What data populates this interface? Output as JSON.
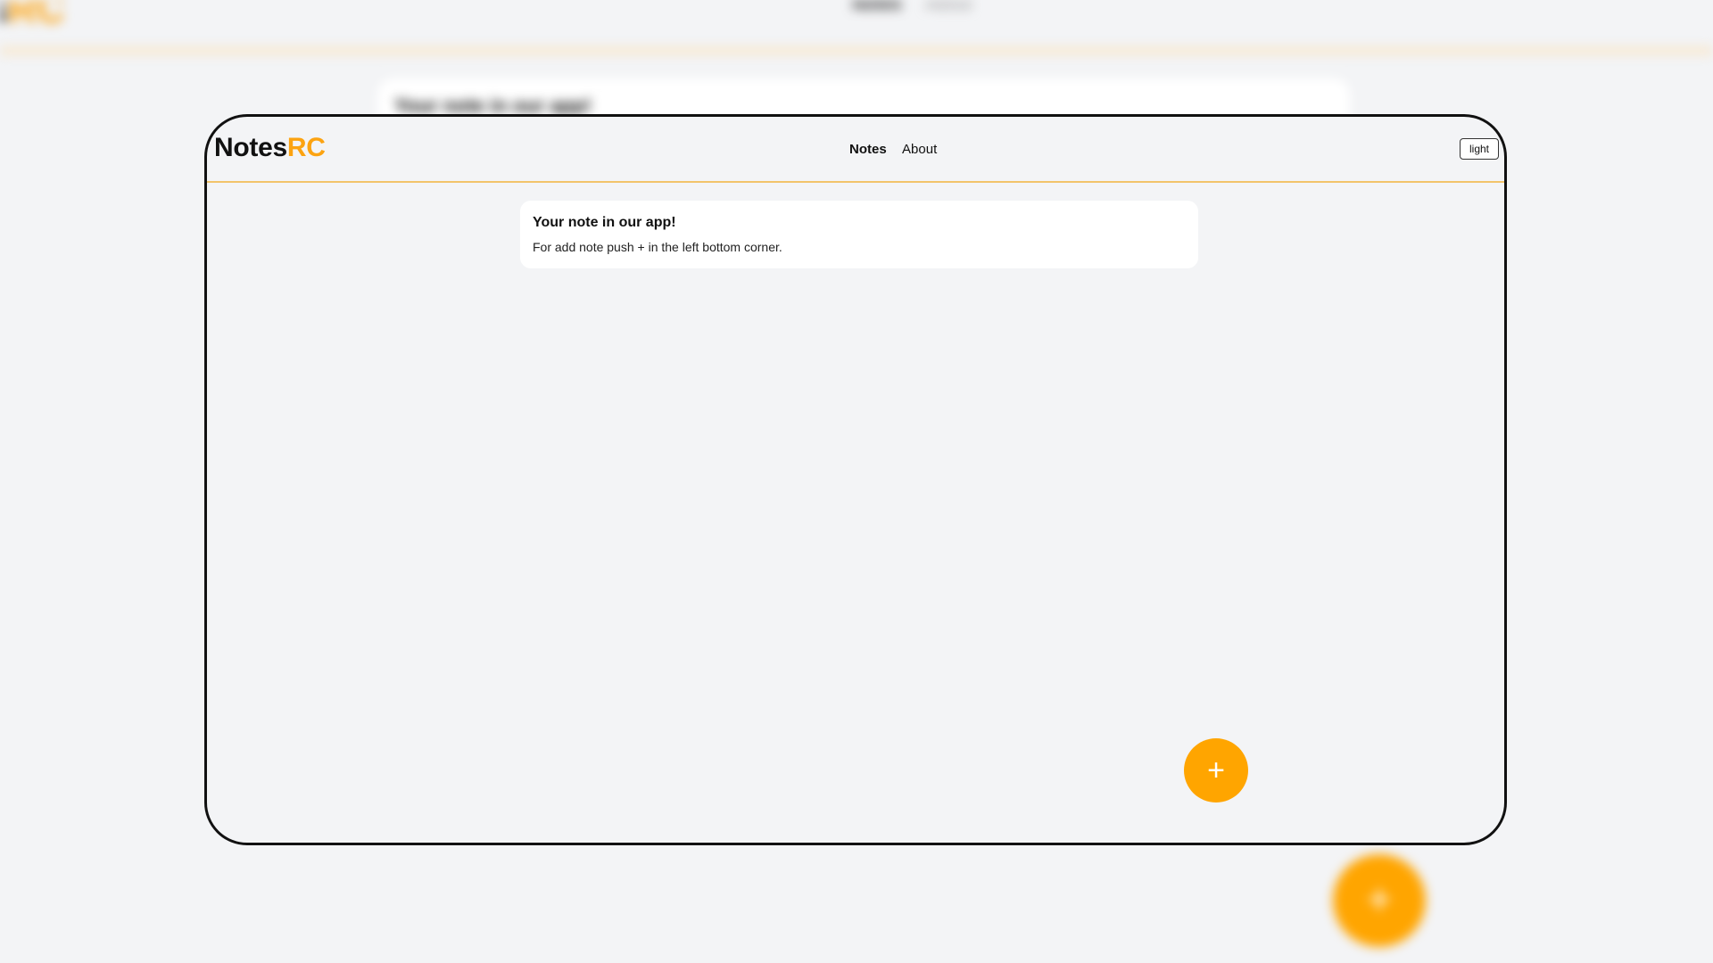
{
  "app": {
    "logo_main": "Notes",
    "logo_accent": "RC"
  },
  "nav": {
    "items": [
      {
        "label": "Notes",
        "active": true
      },
      {
        "label": "About",
        "active": false
      }
    ]
  },
  "header": {
    "theme_toggle_label": "light"
  },
  "note": {
    "title": "Your note in our app!",
    "text": "For add note push + in the left bottom corner."
  },
  "fab": {
    "label": "+"
  },
  "colors": {
    "accent": "#fca311",
    "fab": "#ffa500",
    "background": "#f3f4f6",
    "divider": "#f2c46b"
  },
  "background_blur": {
    "logo_main": "es",
    "logo_accent": "RC",
    "nav_items": [
      "Notes",
      "About"
    ],
    "note_title": "Your note in our app!",
    "fab_label": "+"
  }
}
